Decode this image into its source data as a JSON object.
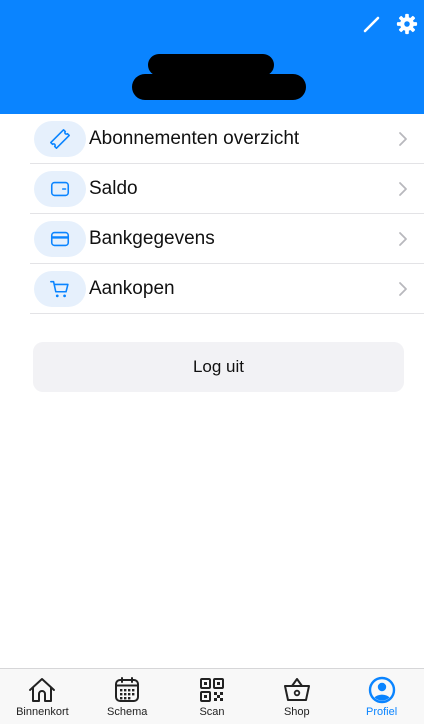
{
  "colors": {
    "primary": "#0a84ff",
    "icon_bg": "#e6f0fc",
    "text": "#111111",
    "divider": "#e3e3e6",
    "logout_bg": "#f2f2f5"
  },
  "header": {
    "edit_icon": "pencil-icon",
    "settings_icon": "gear-icon"
  },
  "menu": {
    "items": [
      {
        "label": "Abonnementen overzicht",
        "icon": "ticket-icon"
      },
      {
        "label": "Saldo",
        "icon": "wallet-icon"
      },
      {
        "label": "Bankgegevens",
        "icon": "credit-card-icon"
      },
      {
        "label": "Aankopen",
        "icon": "cart-icon"
      }
    ]
  },
  "logout": {
    "label": "Log uit"
  },
  "tabbar": {
    "active": "Profiel",
    "tabs": [
      {
        "label": "Binnenkort",
        "icon": "home-icon"
      },
      {
        "label": "Schema",
        "icon": "calendar-icon"
      },
      {
        "label": "Scan",
        "icon": "qr-code-icon"
      },
      {
        "label": "Shop",
        "icon": "basket-icon"
      },
      {
        "label": "Profiel",
        "icon": "person-circle-icon"
      }
    ]
  }
}
